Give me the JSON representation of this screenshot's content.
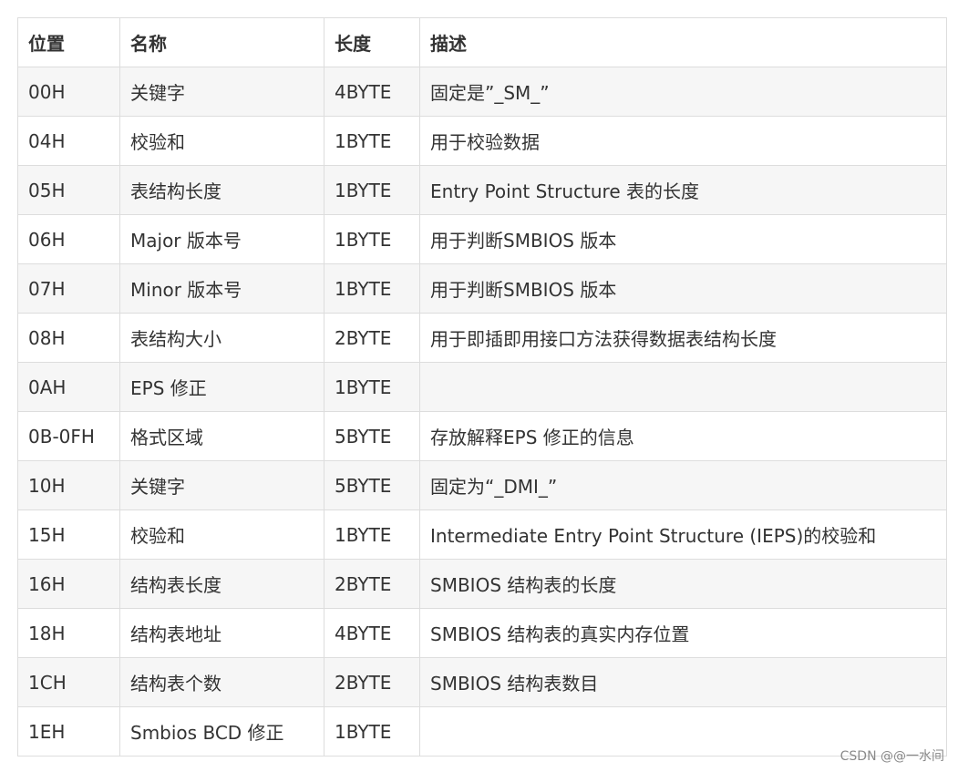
{
  "table": {
    "headers": [
      "位置",
      "名称",
      "长度",
      "描述"
    ],
    "rows": [
      [
        "00H",
        "关键字",
        "4BYTE",
        "固定是”_SM_”"
      ],
      [
        "04H",
        "校验和",
        "1BYTE",
        "用于校验数据"
      ],
      [
        "05H",
        "表结构长度",
        "1BYTE",
        "Entry Point Structure 表的长度"
      ],
      [
        "06H",
        "Major 版本号",
        "1BYTE",
        "用于判断SMBIOS 版本"
      ],
      [
        "07H",
        "Minor 版本号",
        "1BYTE",
        "用于判断SMBIOS 版本"
      ],
      [
        "08H",
        "表结构大小",
        "2BYTE",
        "用于即插即用接口方法获得数据表结构长度"
      ],
      [
        "0AH",
        "EPS 修正",
        "1BYTE",
        ""
      ],
      [
        "0B-0FH",
        "格式区域",
        "5BYTE",
        "存放解释EPS 修正的信息"
      ],
      [
        "10H",
        "关键字",
        "5BYTE",
        "固定为“_DMI_”"
      ],
      [
        "15H",
        "校验和",
        "1BYTE",
        "Intermediate Entry Point Structure (IEPS)的校验和"
      ],
      [
        "16H",
        "结构表长度",
        "2BYTE",
        "SMBIOS 结构表的长度"
      ],
      [
        "18H",
        "结构表地址",
        "4BYTE",
        "SMBIOS 结构表的真实内存位置"
      ],
      [
        "1CH",
        "结构表个数",
        "2BYTE",
        "SMBIOS 结构表数目"
      ],
      [
        "1EH",
        "Smbios BCD 修正",
        "1BYTE",
        ""
      ]
    ]
  },
  "watermark": "CSDN @@一水间"
}
